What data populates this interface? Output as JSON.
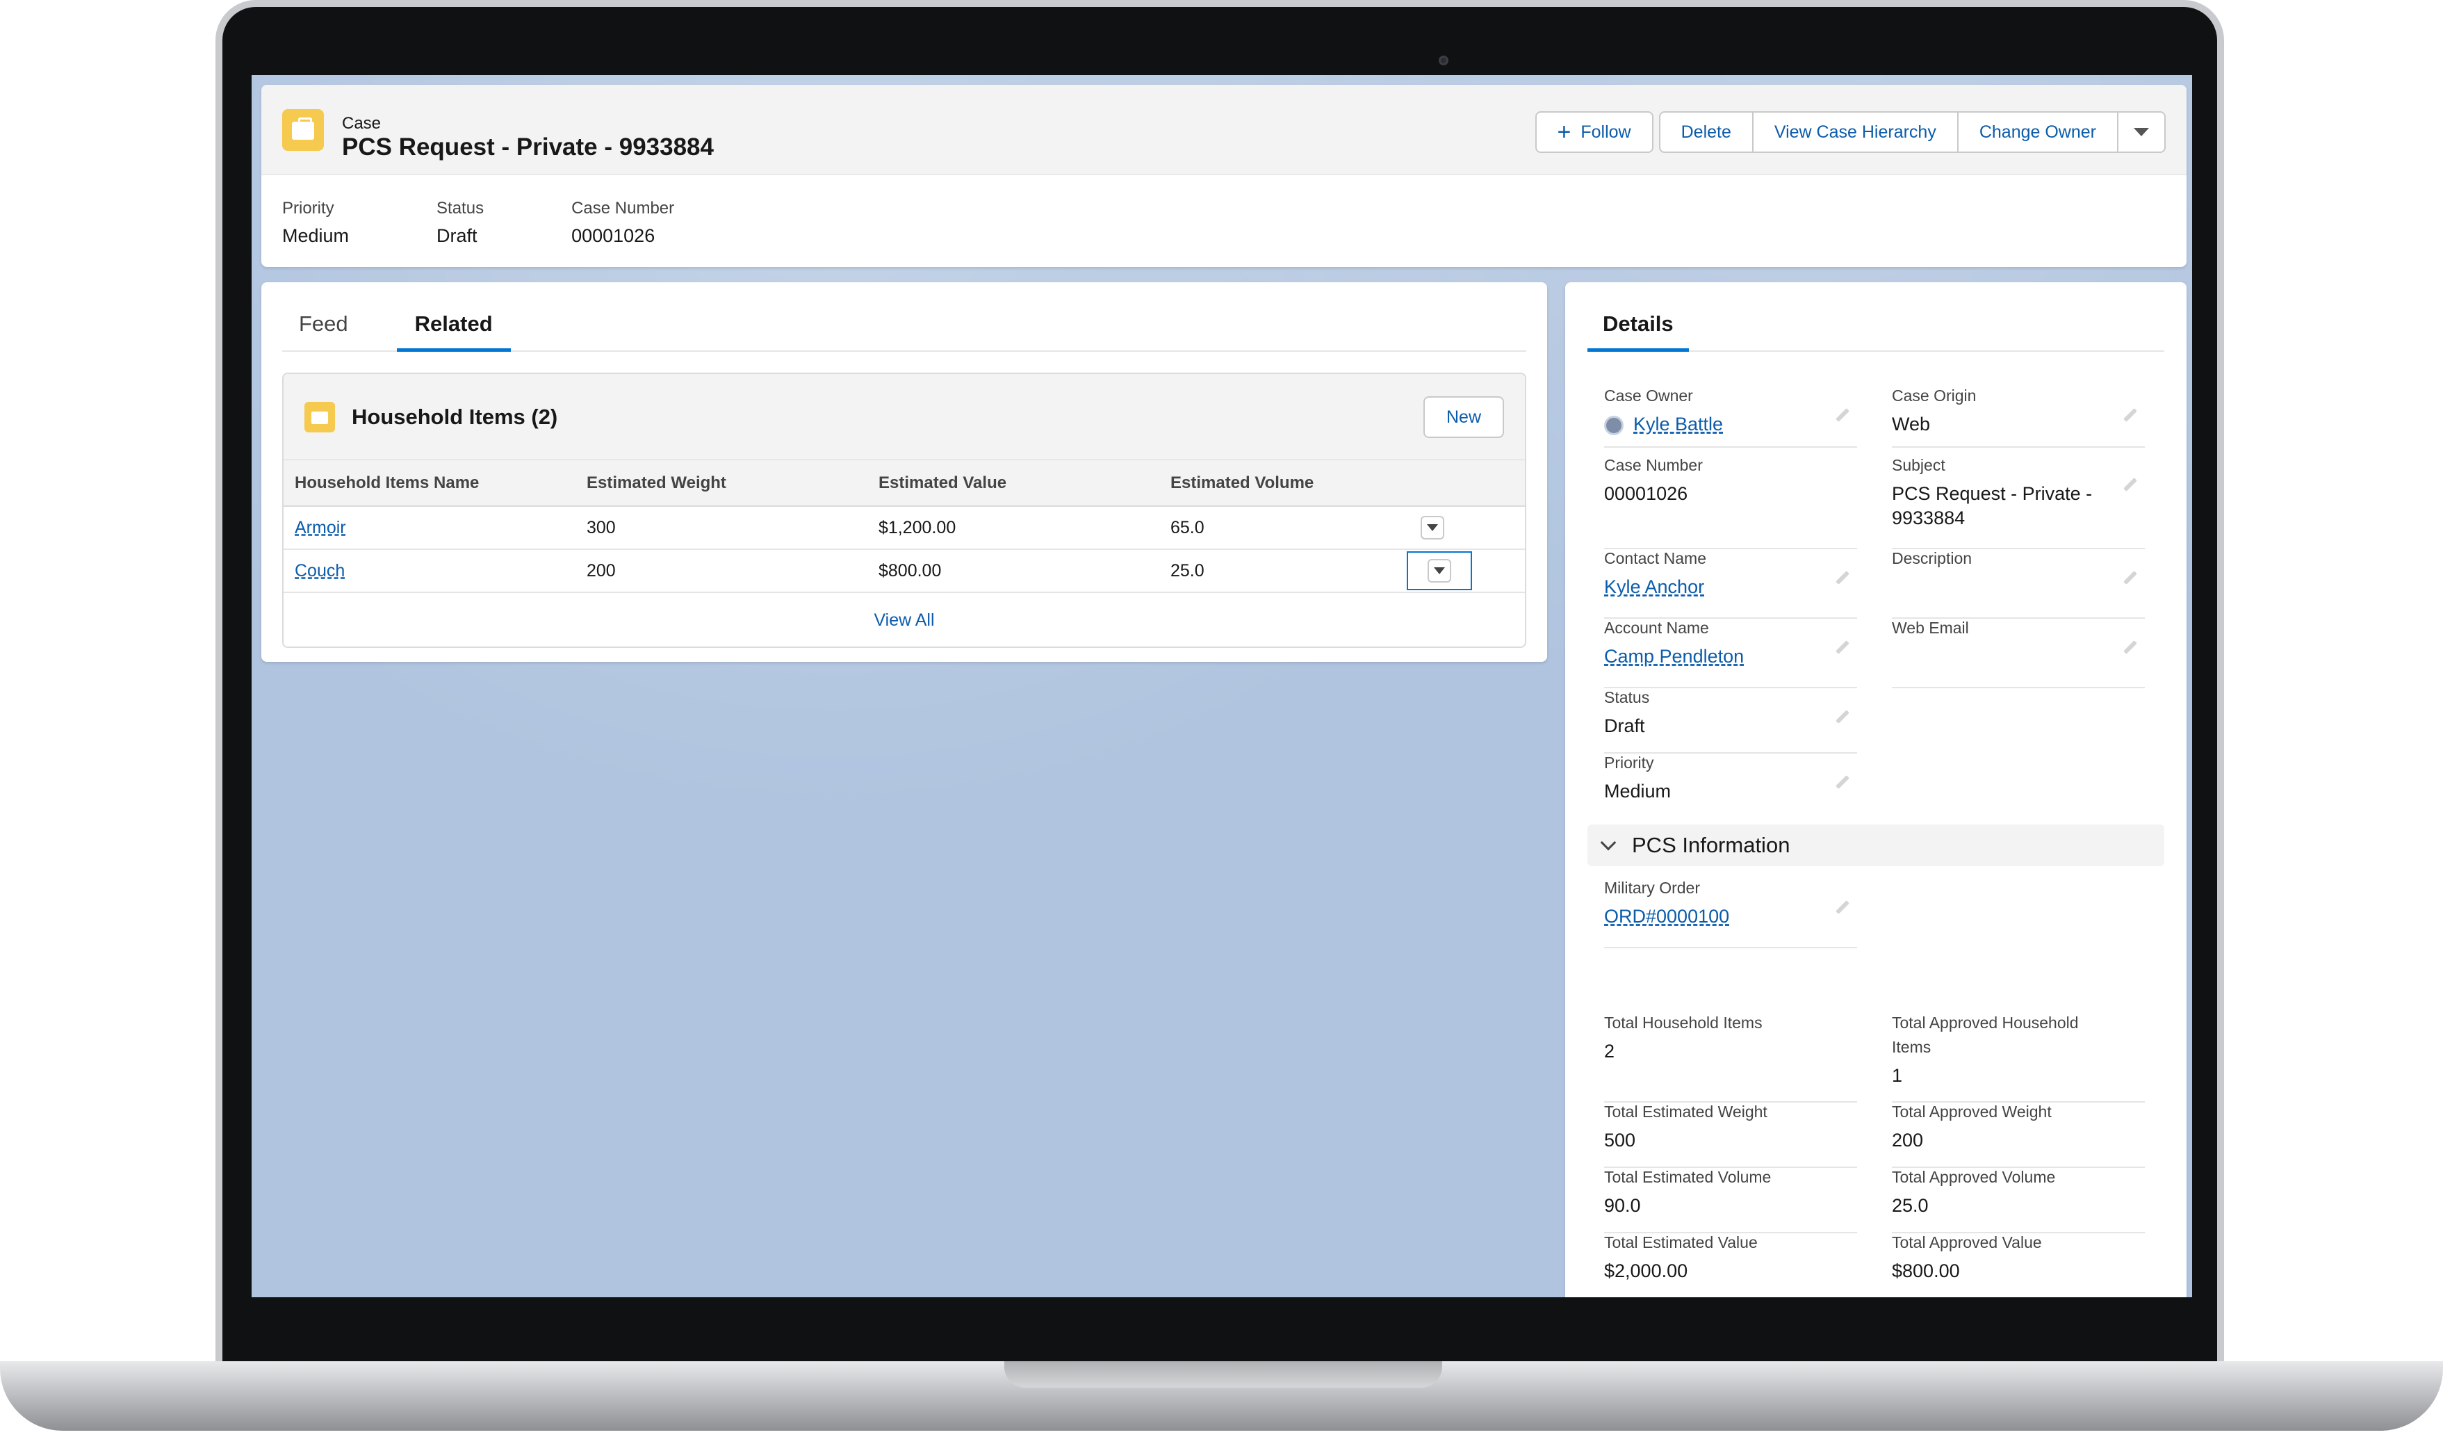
{
  "header": {
    "object_label": "Case",
    "title": "PCS Request - Private - 9933884",
    "buttons": {
      "follow": "Follow",
      "delete": "Delete",
      "hierarchy": "View Case Hierarchy",
      "change_owner": "Change Owner"
    },
    "highlights": [
      {
        "label": "Priority",
        "value": "Medium"
      },
      {
        "label": "Status",
        "value": "Draft"
      },
      {
        "label": "Case Number",
        "value": "00001026"
      }
    ]
  },
  "tabs": {
    "feed": "Feed",
    "related": "Related"
  },
  "related": {
    "title": "Household Items (2)",
    "new_button": "New",
    "columns": [
      "Household Items Name",
      "Estimated Weight",
      "Estimated Value",
      "Estimated Volume"
    ],
    "rows": [
      {
        "name": "Armoir",
        "weight": "300",
        "value": "$1,200.00",
        "volume": "65.0"
      },
      {
        "name": "Couch",
        "weight": "200",
        "value": "$800.00",
        "volume": "25.0"
      }
    ],
    "view_all": "View All"
  },
  "details": {
    "tab": "Details",
    "case_owner": {
      "label": "Case Owner",
      "value": "Kyle Battle"
    },
    "case_origin": {
      "label": "Case Origin",
      "value": "Web"
    },
    "case_number": {
      "label": "Case Number",
      "value": "00001026"
    },
    "subject": {
      "label": "Subject",
      "value": "PCS Request - Private -",
      "value2": "9933884"
    },
    "contact_name": {
      "label": "Contact Name",
      "value": "Kyle Anchor"
    },
    "description": {
      "label": "Description",
      "value": ""
    },
    "account_name": {
      "label": "Account Name",
      "value": "Camp Pendleton"
    },
    "web_email": {
      "label": "Web Email",
      "value": ""
    },
    "status": {
      "label": "Status",
      "value": "Draft"
    },
    "priority": {
      "label": "Priority",
      "value": "Medium"
    },
    "section": "PCS Information",
    "military_order": {
      "label": "Military Order",
      "value": "ORD#0000100"
    },
    "total_household": {
      "label": "Total Household Items",
      "value": "2"
    },
    "total_approved_household": {
      "label": "Total Approved Household",
      "label2": "Items",
      "value": "1"
    },
    "total_est_weight": {
      "label": "Total Estimated Weight",
      "value": "500"
    },
    "total_appr_weight": {
      "label": "Total Approved Weight",
      "value": "200"
    },
    "total_est_volume": {
      "label": "Total Estimated Volume",
      "value": "90.0"
    },
    "total_appr_volume": {
      "label": "Total Approved Volume",
      "value": "25.0"
    },
    "total_est_value": {
      "label": "Total Estimated Value",
      "value": "$2,000.00"
    },
    "total_appr_value": {
      "label": "Total Approved Value",
      "value": "$800.00"
    }
  },
  "colors": {
    "brand_blue": "#0176d3",
    "link": "#0b5cab",
    "case_icon": "#f6c94f",
    "background": "#b0c4df"
  }
}
